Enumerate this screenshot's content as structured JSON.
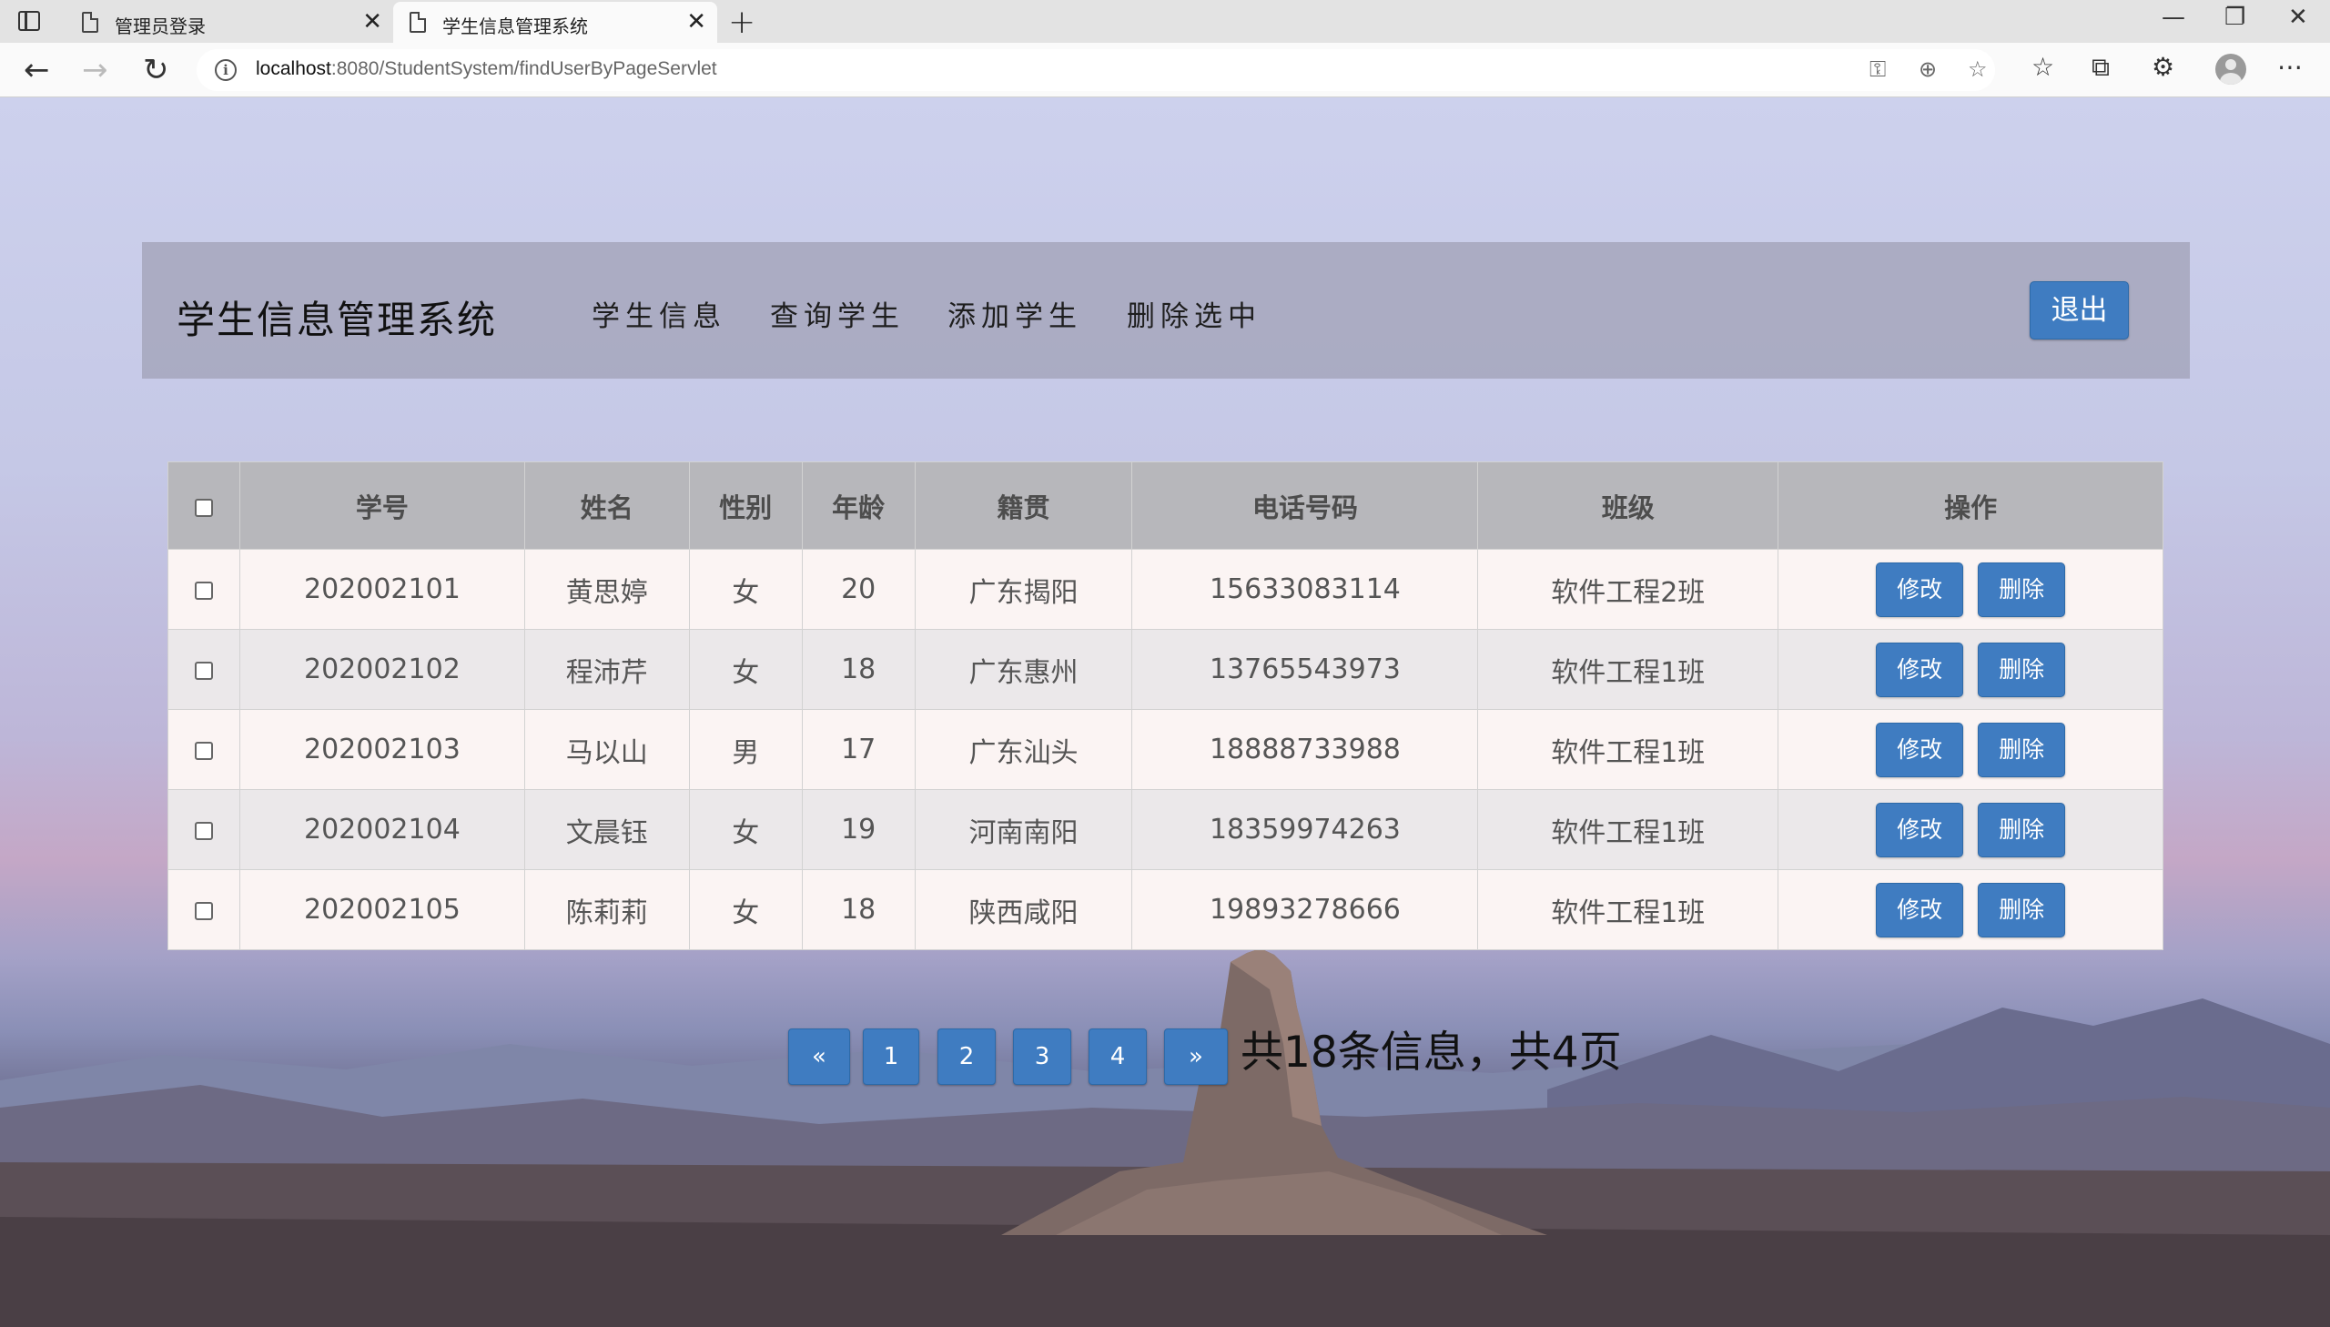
{
  "browser": {
    "tabs": [
      {
        "label": "管理员登录",
        "close": "✕"
      },
      {
        "label": "学生信息管理系统",
        "close": "✕"
      }
    ],
    "new_tab": "+",
    "window": {
      "minimize": "—",
      "restore": "❐",
      "close": "✕"
    },
    "nav": {
      "back": "←",
      "forward": "→",
      "reload": "↻",
      "info": "i"
    },
    "url_host": "localhost",
    "url_path": ":8080/StudentSystem/findUserByPageServlet",
    "toolbar": {
      "key": "⚿",
      "zoom": "⊕",
      "fav_add": "☆",
      "favorites": "☆",
      "collections": "⧉",
      "extensions": "⚙",
      "more": "⋯"
    }
  },
  "header": {
    "brand": "学生信息管理系统",
    "menu": [
      "学生信息",
      "查询学生",
      "添加学生",
      "删除选中"
    ],
    "logout": "退出"
  },
  "table": {
    "columns": [
      "学号",
      "姓名",
      "性别",
      "年龄",
      "籍贯",
      "电话号码",
      "班级",
      "操作"
    ],
    "rows": [
      {
        "id": "202002101",
        "name": "黄思婷",
        "gender": "女",
        "age": "20",
        "origin": "广东揭阳",
        "phone": "15633083114",
        "class": "软件工程2班"
      },
      {
        "id": "202002102",
        "name": "程沛芹",
        "gender": "女",
        "age": "18",
        "origin": "广东惠州",
        "phone": "13765543973",
        "class": "软件工程1班"
      },
      {
        "id": "202002103",
        "name": "马以山",
        "gender": "男",
        "age": "17",
        "origin": "广东汕头",
        "phone": "18888733988",
        "class": "软件工程1班"
      },
      {
        "id": "202002104",
        "name": "文晨钰",
        "gender": "女",
        "age": "19",
        "origin": "河南南阳",
        "phone": "18359974263",
        "class": "软件工程1班"
      },
      {
        "id": "202002105",
        "name": "陈莉莉",
        "gender": "女",
        "age": "18",
        "origin": "陕西咸阳",
        "phone": "19893278666",
        "class": "软件工程1班"
      }
    ],
    "edit_label": "修改",
    "delete_label": "删除"
  },
  "pagination": {
    "prev": "«",
    "pages": [
      "1",
      "2",
      "3",
      "4"
    ],
    "next": "»",
    "summary": "共18条信息，共4页"
  }
}
